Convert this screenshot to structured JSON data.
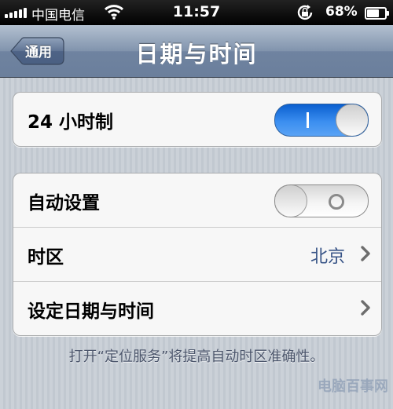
{
  "status_bar": {
    "carrier": "中国电信",
    "time": "11:57",
    "battery_percent": "68%",
    "battery_level": 0.68,
    "icons": [
      "signal-bars-icon",
      "wifi-icon",
      "rotation-lock-icon",
      "battery-icon"
    ]
  },
  "nav": {
    "back_label": "通用",
    "title": "日期与时间"
  },
  "group1": {
    "row_24h": {
      "label": "24 小时制",
      "toggle_on": true
    }
  },
  "group2": {
    "row_auto": {
      "label": "自动设置",
      "toggle_on": false
    },
    "row_timezone": {
      "label": "时区",
      "value": "北京"
    },
    "row_set_datetime": {
      "label": "设定日期与时间"
    }
  },
  "footer_note": "打开“定位服务”将提高自动时区准确性。",
  "watermark": "电脑百事网"
}
